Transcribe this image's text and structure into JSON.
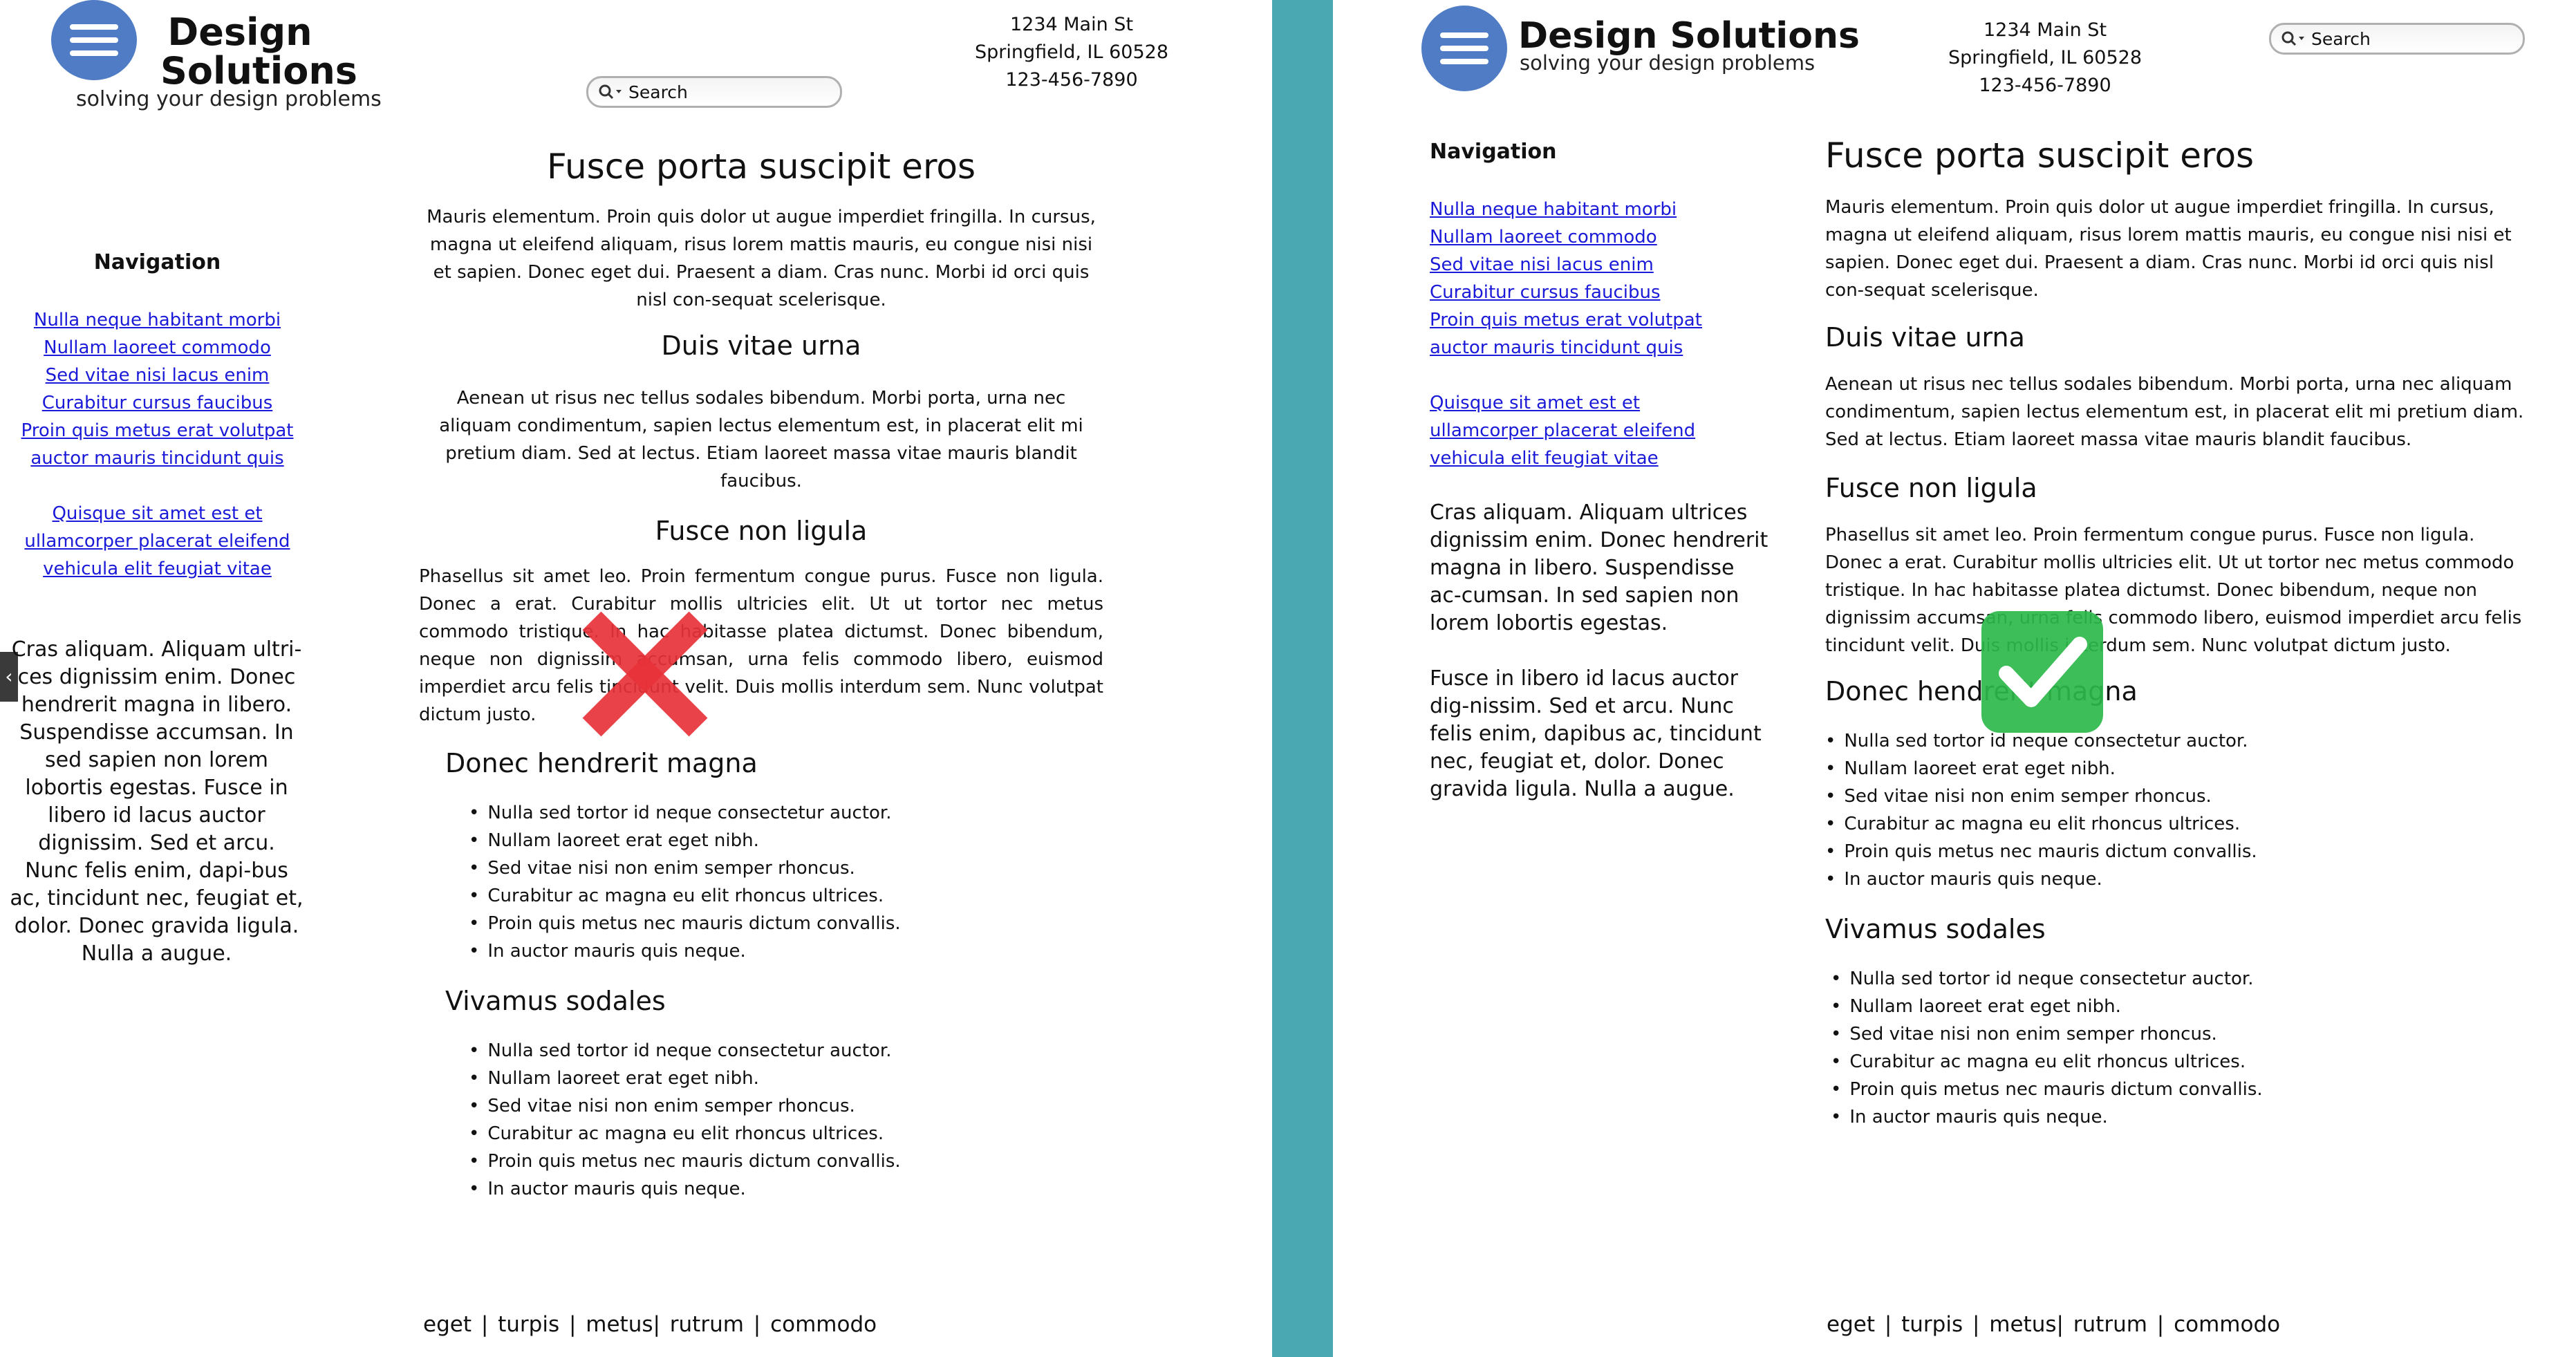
{
  "site": {
    "brand_line1": "Design",
    "brand_line2": "Solutions",
    "brand_full": "Design Solutions",
    "tagline": "solving your design problems",
    "address": [
      "1234 Main St",
      "Springfield, IL 60528",
      "123-456-7890"
    ],
    "search_placeholder": "Search"
  },
  "nav": {
    "title": "Navigation",
    "group1": [
      "Nulla neque habitant morbi",
      "Nullam laoreet commodo",
      "Sed vitae nisi lacus enim",
      "Curabitur cursus faucibus",
      "Proin quis metus erat volutpat",
      "auctor mauris tincidunt quis"
    ],
    "group2": [
      "Quisque sit amet est et",
      "ullamcorper placerat eleifend",
      "vehicula elit feugiat vitae"
    ]
  },
  "sidebar_text": {
    "left": "Cras aliquam. Aliquam ultri-ces dignissim enim. Donec hendrerit magna in libero. Suspendisse accumsan. In sed sapien non lorem lobortis egestas. Fusce in libero id lacus auctor dignissim. Sed et arcu. Nunc felis enim, dapi-bus ac, tincidunt nec, feugiat et, dolor. Donec gravida ligula. Nulla a augue.",
    "right_p1": "Cras aliquam. Aliquam ultrices dignissim enim. Donec hendrerit magna in libero. Suspendisse ac-cumsan. In sed sapien non lorem lobortis egestas.",
    "right_p2": "Fusce in libero id lacus auctor dig-nissim. Sed et arcu. Nunc felis enim, dapibus ac, tincidunt nec, feugiat et, dolor. Donec gravida ligula. Nulla a augue."
  },
  "content": {
    "title": "Fusce porta suscipit eros",
    "p1": "Mauris elementum. Proin quis dolor ut augue imperdiet fringilla. In cursus, magna ut eleifend aliquam, risus lorem mattis mauris, eu congue nisi nisi et sapien. Donec eget dui. Praesent a diam. Cras nunc. Morbi id orci quis nisl con-sequat scelerisque.",
    "h2": "Duis vitae urna",
    "p2": "Aenean ut risus nec tellus sodales bibendum. Morbi porta, urna nec aliquam condimentum, sapien lectus elementum est, in placerat elit mi pretium diam. Sed at lectus. Etiam laoreet massa vitae mauris blandit faucibus.",
    "h3": "Fusce non ligula",
    "p3": "Phasellus sit amet leo. Proin fermentum congue purus. Fusce non ligula. Donec a erat. Curabitur mollis ultricies elit. Ut ut tortor nec metus commodo tristique. In hac habitasse platea dictumst. Donec bibendum, neque non dignissim accumsan, urna felis commodo libero, euismod imperdiet arcu felis tincidunt velit. Duis mollis interdum sem. Nunc volutpat dictum justo.",
    "h4": "Donec hendrerit magna",
    "list1": [
      "Nulla sed tortor id neque consectetur auctor.",
      "Nullam laoreet erat eget nibh.",
      "Sed vitae nisi non enim semper rhoncus.",
      "Curabitur ac magna eu elit rhoncus ultrices.",
      "Proin quis metus nec mauris dictum convallis.",
      "In auctor mauris quis neque."
    ],
    "h5": "Vivamus sodales",
    "list2": [
      "Nulla sed tortor id neque consectetur auctor.",
      "Nullam laoreet erat eget nibh.",
      "Sed vitae nisi non enim semper rhoncus.",
      "Curabitur ac magna eu elit rhoncus ultrices.",
      "Proin quis metus nec mauris dictum convallis.",
      "In auctor mauris quis neque."
    ]
  },
  "footer": "eget | turpis | metus| rutrum | commodo",
  "overlays": {
    "bad_mark": "red-x-icon",
    "good_mark": "green-check-icon",
    "bad_color": "#e8323a",
    "good_color": "#2db84a",
    "divider_color": "#4aa8b3"
  }
}
